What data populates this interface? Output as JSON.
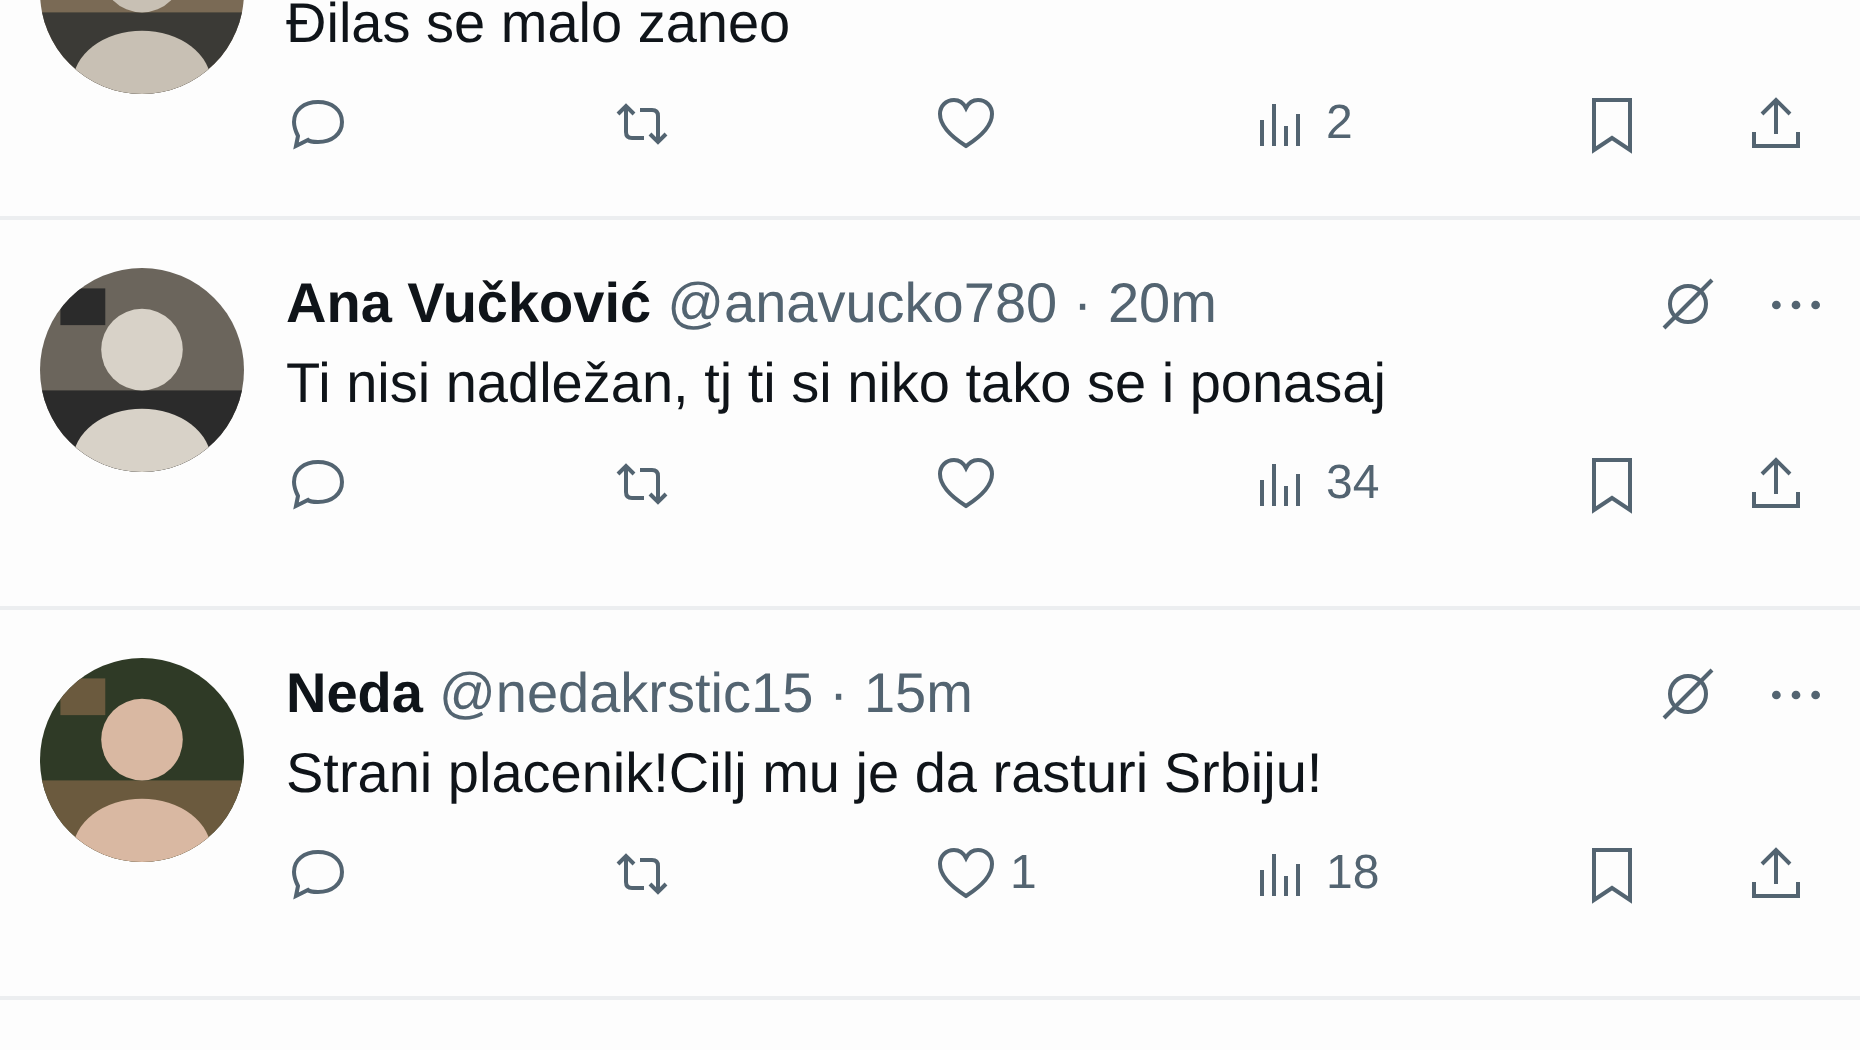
{
  "tweets": [
    {
      "text": "Đilas se malo zaneo",
      "views": "2"
    },
    {
      "author": "Ana Vučković",
      "handle": "@anavucko780",
      "separator": "·",
      "time": "20m",
      "text": "Ti nisi nadležan, tj ti si niko tako se i ponasaj",
      "views": "34"
    },
    {
      "author": "Neda",
      "handle": "@nedakrstic15",
      "separator": "·",
      "time": "15m",
      "text": "Strani placenik!Cilj mu je da rasturi Srbiju!",
      "likes": "1",
      "views": "18"
    }
  ]
}
